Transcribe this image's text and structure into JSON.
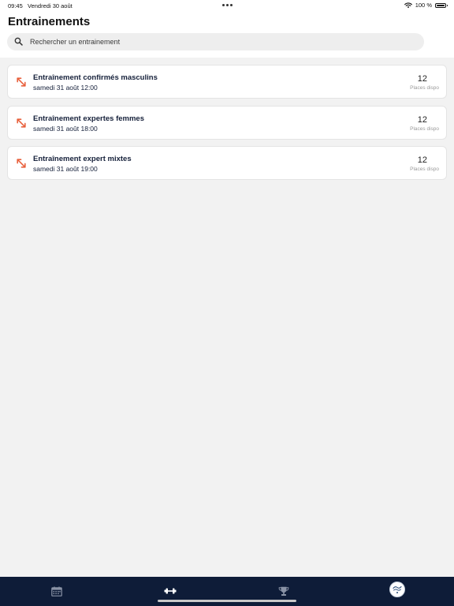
{
  "status_bar": {
    "time": "09:45",
    "date": "Vendredi 30 août",
    "battery": "100 %",
    "battery_level": 1.0
  },
  "header": {
    "title": "Entrainements"
  },
  "search": {
    "placeholder": "Rechercher un entrainement"
  },
  "trainings": [
    {
      "title": "Entraînement confirmés masculins",
      "date": "samedi 31 août 12:00",
      "places": "12",
      "places_label": "Places dispo"
    },
    {
      "title": "Entraînement expertes femmes",
      "date": "samedi 31 août 18:00",
      "places": "12",
      "places_label": "Places dispo"
    },
    {
      "title": "Entraînement expert mixtes",
      "date": "samedi 31 août 19:00",
      "places": "12",
      "places_label": "Places dispo"
    }
  ],
  "tab_bar": {
    "tabs": [
      {
        "icon": "calendar-icon",
        "active": false
      },
      {
        "icon": "dumbbell-icon",
        "active": true
      },
      {
        "icon": "trophy-icon",
        "active": false
      },
      {
        "icon": "profile-avatar-icon",
        "active": false
      }
    ]
  },
  "colors": {
    "accent": "#e8603c",
    "tab_bar_background": "#0e1c38",
    "title_text": "#15203a",
    "page_background": "#f2f2f2"
  }
}
